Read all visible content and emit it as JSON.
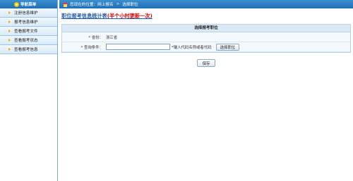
{
  "sidebar": {
    "header": "导航菜单",
    "items": [
      {
        "label": "注册信息维护"
      },
      {
        "label": "报考信息维护"
      },
      {
        "label": "查看报考文件"
      },
      {
        "label": "查看报考状态"
      },
      {
        "label": "查看报考信息"
      }
    ]
  },
  "breadcrumb": {
    "prefix": "您现在的位置：",
    "path1": "网上报名",
    "separator": ">",
    "path2": "选择职位"
  },
  "main": {
    "title": "职位报考信息统计表",
    "title_note": "(半个小时更新一次)",
    "panel_header": "选择报考职位",
    "province_label": "* 省份：",
    "province_value": "浙江省",
    "query_label": "* 查询条件：",
    "query_value": "",
    "query_hint": "*输入代码名称或者代码",
    "select_button": "选择职位",
    "save_button": "保存"
  },
  "colors": {
    "header_blue": "#1f6fb4",
    "title_blue": "#1f5aa8",
    "title_red": "#d40000"
  }
}
